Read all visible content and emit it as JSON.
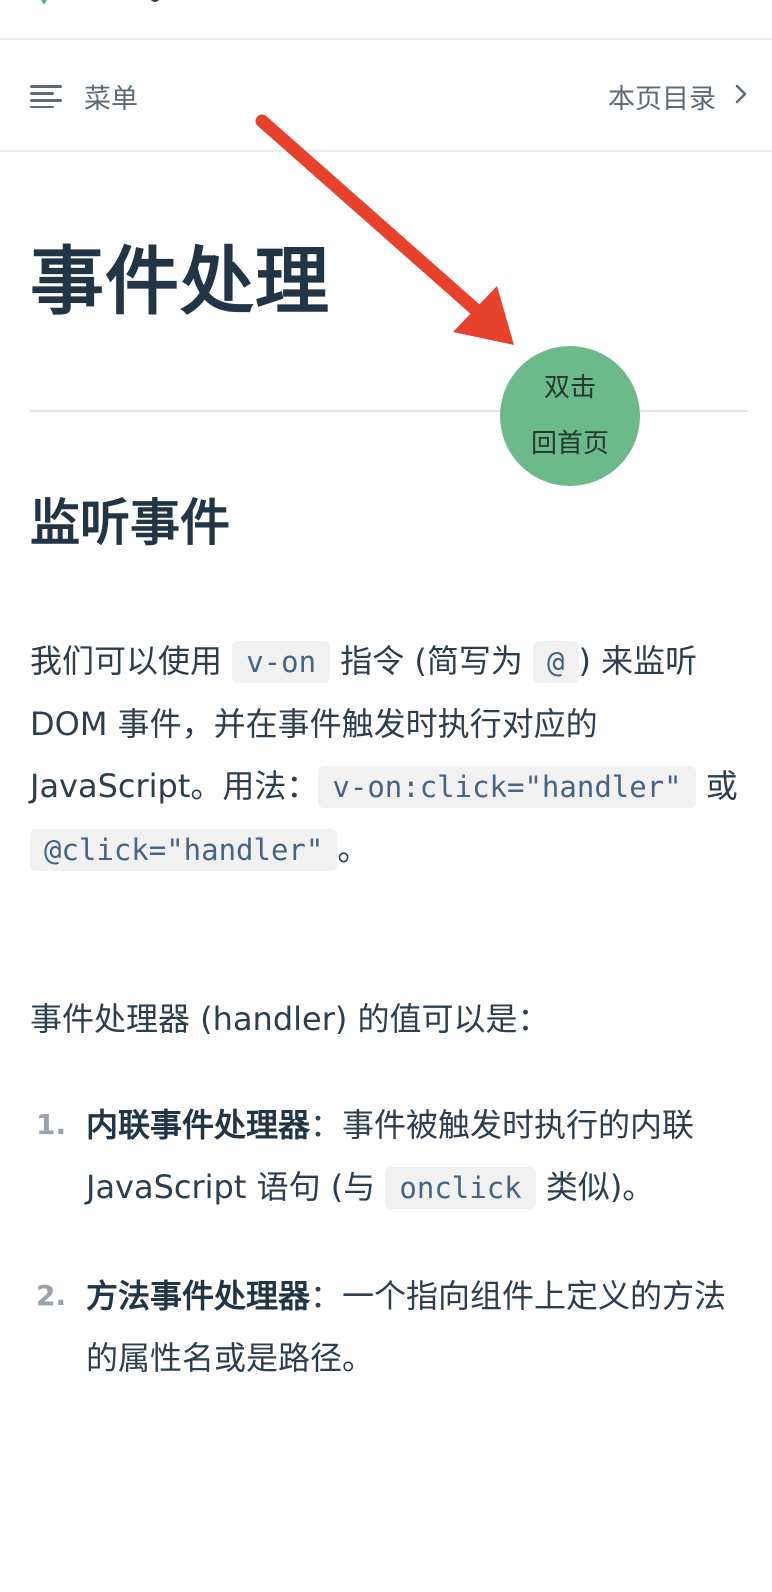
{
  "header": {
    "menu_label": "菜单",
    "toc_label": "本页目录",
    "menu_icon": "hamburger-icon",
    "toc_icon": "chevron-right-icon"
  },
  "article": {
    "title": "事件处理",
    "section_title": "监听事件",
    "paragraph1": {
      "t1": "我们可以使用 ",
      "code1": "v-on",
      "t2": " 指令 (简写为 ",
      "code2": "@",
      "t3": ") 来监听 DOM 事件，并在事件触发时执行对应的 JavaScript。用法：",
      "code3": "v-on:click=\"handler\"",
      "t4": " 或 ",
      "code4": "@click=\"handler\"",
      "t5": "。"
    },
    "paragraph2": "事件处理器 (handler) 的值可以是：",
    "list": [
      {
        "number": "1.",
        "strong": "内联事件处理器",
        "t1": "：事件被触发时执行的内联 JavaScript 语句 (与 ",
        "code": "onclick",
        "t2": " 类似)。"
      },
      {
        "number": "2.",
        "strong": "方法事件处理器",
        "t1": "：一个指向组件上定义的方法的属性名或是路径。"
      }
    ]
  },
  "floating_button": {
    "line1": "双击",
    "line2": "回首页",
    "color": "#6cb98a"
  },
  "annotation": {
    "arrow_color": "#e8412c"
  }
}
